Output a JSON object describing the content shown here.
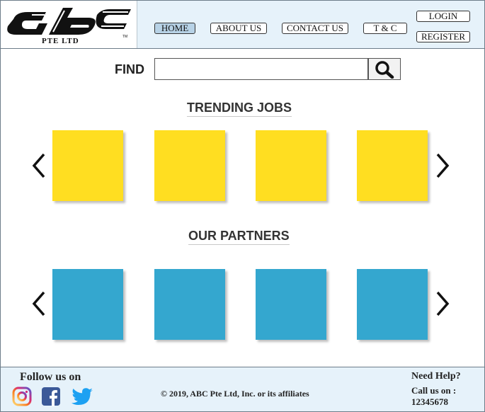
{
  "brand": {
    "logo_text": "abc",
    "subtitle": "PTE LTD"
  },
  "nav": {
    "items": [
      {
        "label": "HOME",
        "active": true
      },
      {
        "label": "ABOUT US",
        "active": false
      },
      {
        "label": "CONTACT US",
        "active": false
      },
      {
        "label": "T & C",
        "active": false
      }
    ],
    "login_label": "LOGIN",
    "register_label": "REGISTER"
  },
  "search": {
    "label": "FIND",
    "value": "",
    "placeholder": "",
    "icon": "search-icon"
  },
  "trending": {
    "title": "TRENDING JOBS",
    "tile_color": "#ffde21",
    "tile_count": 4
  },
  "partners": {
    "title": "OUR PARTNERS",
    "tile_color": "#34a7cf",
    "tile_count": 4
  },
  "footer": {
    "follow_label": "Follow us on",
    "social": [
      "instagram-icon",
      "facebook-icon",
      "twitter-icon"
    ],
    "copyright": "© 2019, ABC Pte Ltd, Inc. or its affiliates",
    "help_title": "Need Help?",
    "call_label": "Call us on :",
    "phone": "12345678"
  },
  "colors": {
    "header_bg": "#e6f2fa",
    "active_nav": "#b7d2e6",
    "facebook": "#3b5998",
    "twitter": "#1da1f2",
    "instagram": "#c13584"
  }
}
